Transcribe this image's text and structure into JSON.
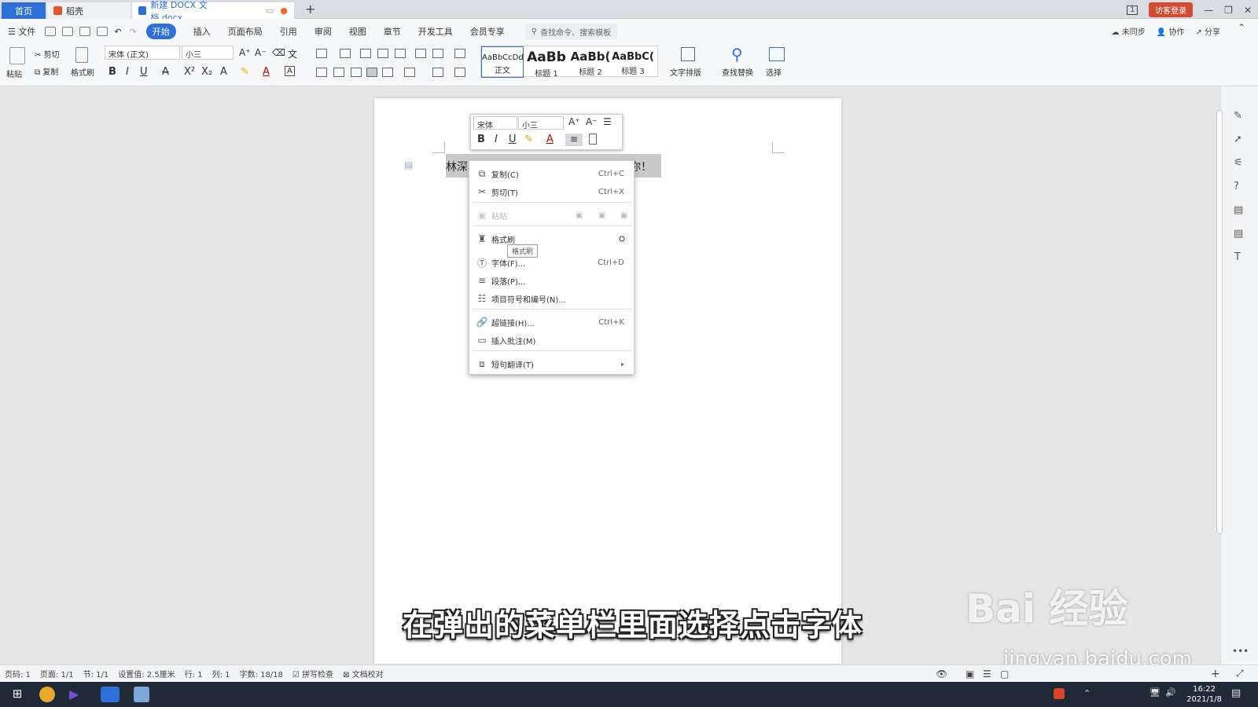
{
  "tabs": {
    "home": "首页",
    "daoke": "稻壳",
    "doc": "新建 DOCX 文档.docx"
  },
  "window": {
    "login": "访客登录",
    "badge": "1"
  },
  "menu": {
    "file": "文件",
    "items": [
      "开始",
      "插入",
      "页面布局",
      "引用",
      "审阅",
      "视图",
      "章节",
      "开发工具",
      "会员专享"
    ],
    "search": "查找命令、搜索模板",
    "sync": "未同步",
    "collab": "协作",
    "share": "分享"
  },
  "toolbar": {
    "paste": "粘贴",
    "cut": "剪切",
    "copy": "复制",
    "format_painter": "格式刷",
    "font": "宋体 (正文)",
    "size": "小三",
    "text_layout": "文字排版",
    "find_replace": "查找替换",
    "select": "选择"
  },
  "styles": [
    {
      "sample": "AaBbCcDd",
      "name": "正文"
    },
    {
      "sample": "AaBb",
      "name": "标题 1"
    },
    {
      "sample": "AaBb(",
      "name": "标题 2"
    },
    {
      "sample": "AaBbC(",
      "name": "标题 3"
    }
  ],
  "document": {
    "text_start": "林深",
    "text_end": "你！"
  },
  "minibar": {
    "font": "宋体",
    "size": "小三"
  },
  "context_menu": {
    "items": [
      {
        "label": "复制(C)",
        "shortcut": "Ctrl+C"
      },
      {
        "label": "剪切(T)",
        "shortcut": "Ctrl+X"
      },
      {
        "label": "粘贴",
        "shortcut": ""
      },
      {
        "label": "格式刷",
        "shortcut": ""
      },
      {
        "label": "字体(F)...",
        "shortcut": "Ctrl+D"
      },
      {
        "label": "段落(P)...",
        "shortcut": ""
      },
      {
        "label": "项目符号和编号(N)...",
        "shortcut": ""
      },
      {
        "label": "超链接(H)...",
        "shortcut": "Ctrl+K"
      },
      {
        "label": "插入批注(M)",
        "shortcut": ""
      },
      {
        "label": "短句翻译(T)",
        "shortcut": ""
      }
    ],
    "tooltip": "格式刷"
  },
  "caption": "在弹出的菜单栏里面选择点击字体",
  "watermark": {
    "main": "Bai 经验",
    "url": "jingyan.baidu.com"
  },
  "status": {
    "page_no": "页码: 1",
    "pages": "页面: 1/1",
    "section": "节: 1/1",
    "setting": "设置值: 2.5厘米",
    "row": "行: 1",
    "col": "列: 1",
    "words": "字数: 18/18",
    "spell": "拼写检查",
    "proof": "文档校对"
  },
  "taskbar": {
    "time": "16:22",
    "date": "2021/1/8"
  }
}
